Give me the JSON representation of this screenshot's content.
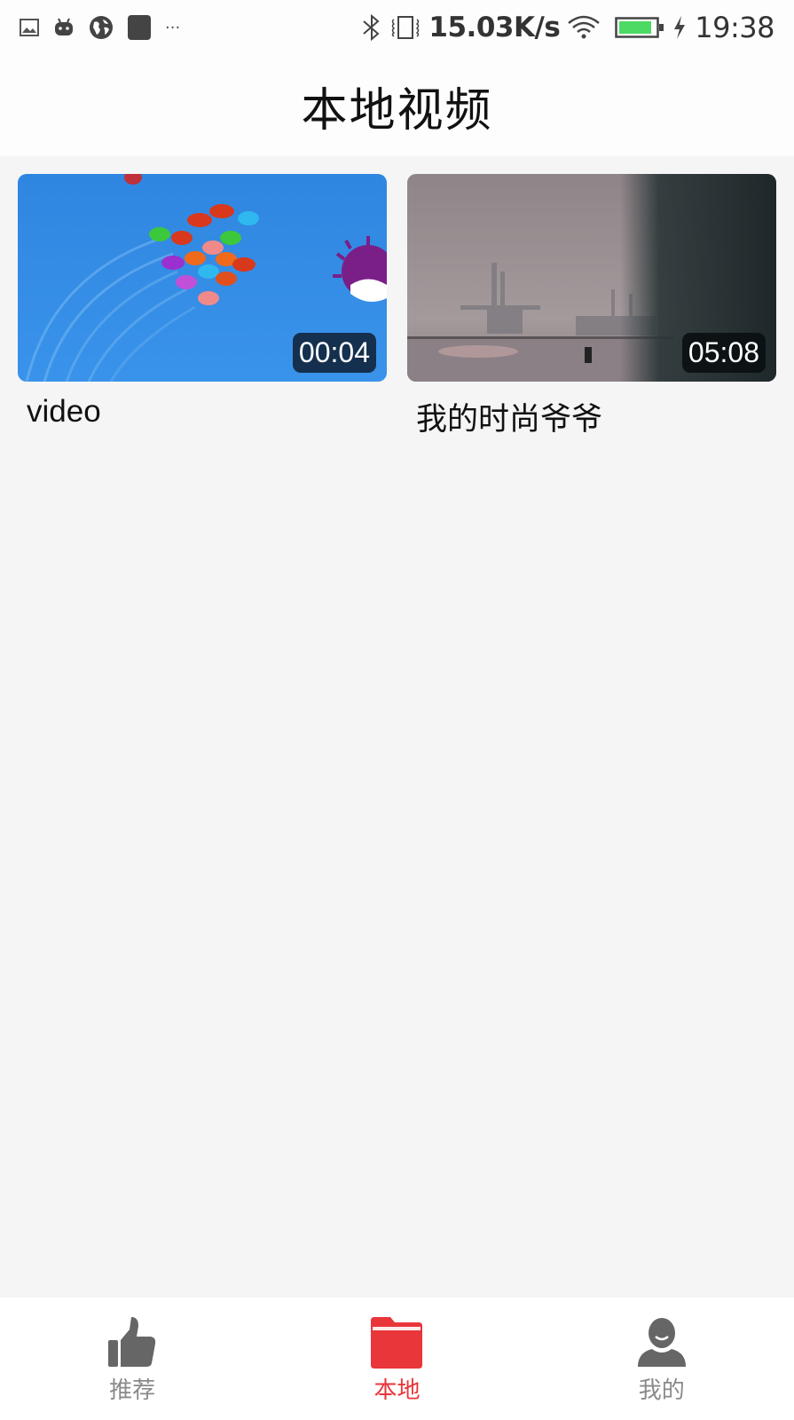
{
  "status_bar": {
    "left_icons": [
      "image-icon",
      "android-icon",
      "globe-icon",
      "square-app-icon",
      "more-dots-icon"
    ],
    "more_dots": "···",
    "right_icons": [
      "bluetooth-icon",
      "vibrate-icon",
      "wifi-icon",
      "battery-icon",
      "charging-icon"
    ],
    "network_speed": "15.03K/s",
    "battery_color": "#4cd964",
    "time": "19:38"
  },
  "header": {
    "title": "本地视频"
  },
  "videos": [
    {
      "title": "video",
      "duration": "00:04",
      "thumbnail": "cartoon-fish-thumbnail"
    },
    {
      "title": "我的时尚爷爷",
      "duration": "05:08",
      "thumbnail": "harbor-cranes-thumbnail"
    }
  ],
  "tab_bar": {
    "active_color": "#e8363a",
    "inactive_color": "#8a8a8a",
    "tabs": [
      {
        "label": "推荐",
        "icon": "thumbs-up-icon",
        "active": false
      },
      {
        "label": "本地",
        "icon": "folder-icon",
        "active": true
      },
      {
        "label": "我的",
        "icon": "user-icon",
        "active": false
      }
    ]
  }
}
